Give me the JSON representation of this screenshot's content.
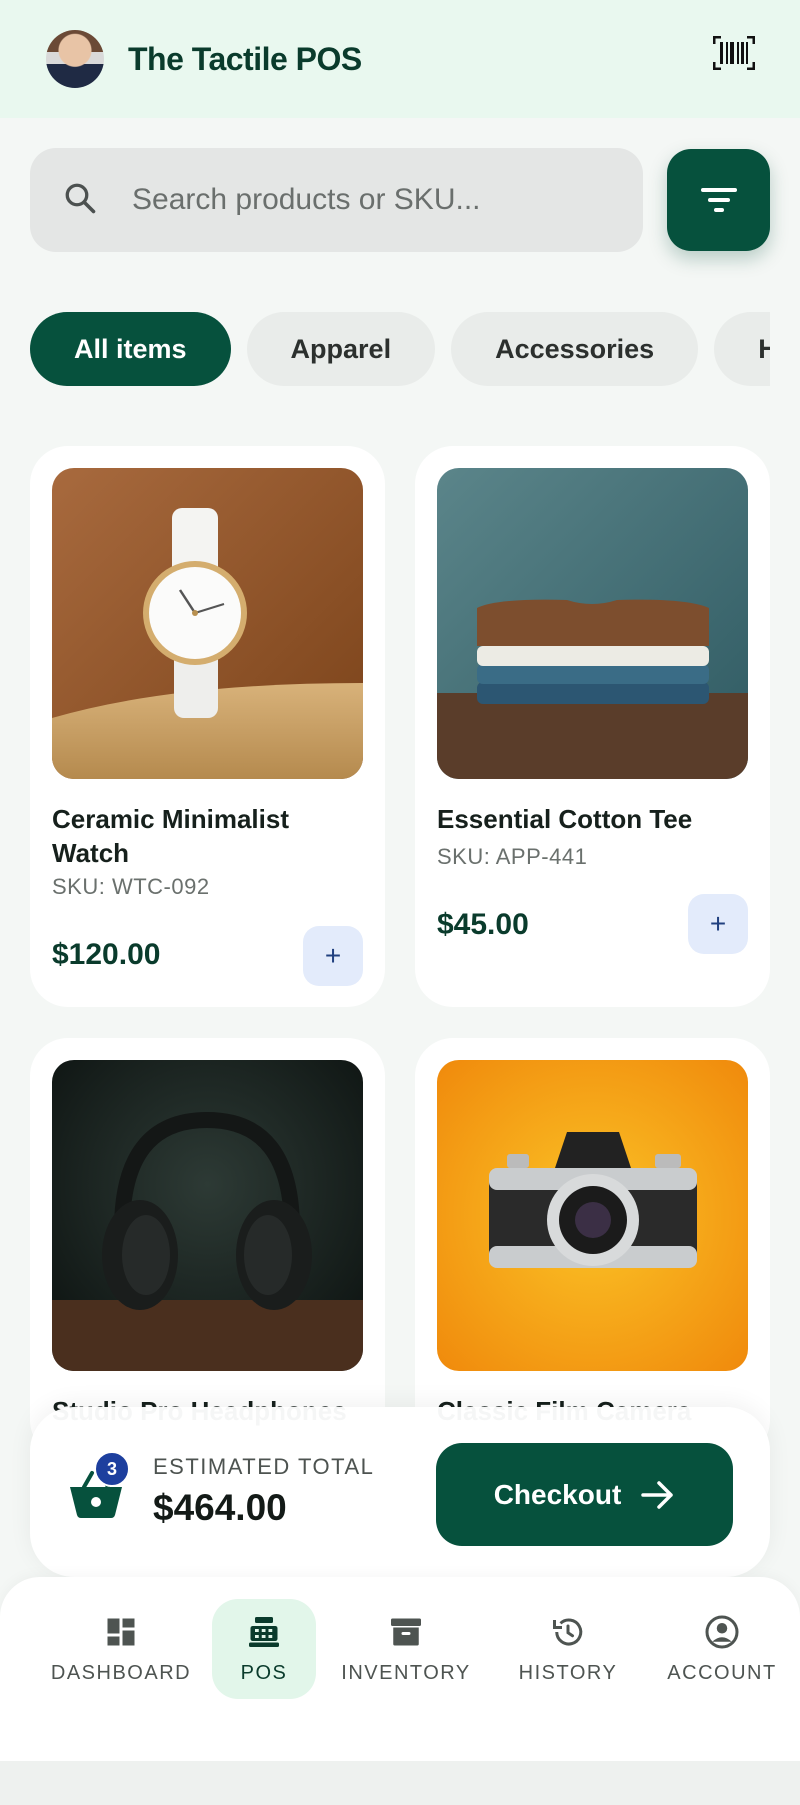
{
  "header": {
    "title": "The Tactile POS"
  },
  "search": {
    "placeholder": "Search products or SKU..."
  },
  "categories": [
    "All items",
    "Apparel",
    "Accessories",
    "H"
  ],
  "products": [
    {
      "name": "Ceramic Minimalist Watch",
      "sku": "SKU: WTC-092",
      "price": "$120.00",
      "add": "+"
    },
    {
      "name": "Essential Cotton Tee",
      "sku": "SKU: APP-441",
      "price": "$45.00",
      "add": "+"
    },
    {
      "name": "Studio Pro Headphones",
      "image": "headphones"
    },
    {
      "name": "Classic Film Camera",
      "image": "camera"
    }
  ],
  "cart": {
    "count": "3",
    "label": "ESTIMATED TOTAL",
    "total": "$464.00",
    "checkout": "Checkout"
  },
  "nav": [
    {
      "label": "DASHBOARD",
      "icon": "dashboard-icon"
    },
    {
      "label": "POS",
      "icon": "register-icon"
    },
    {
      "label": "INVENTORY",
      "icon": "archive-icon"
    },
    {
      "label": "HISTORY",
      "icon": "history-icon"
    },
    {
      "label": "ACCOUNT",
      "icon": "account-icon"
    }
  ],
  "colors": {
    "primary": "#06513d",
    "header_bg": "#e9f8ef",
    "badge": "#1d3f9e"
  }
}
